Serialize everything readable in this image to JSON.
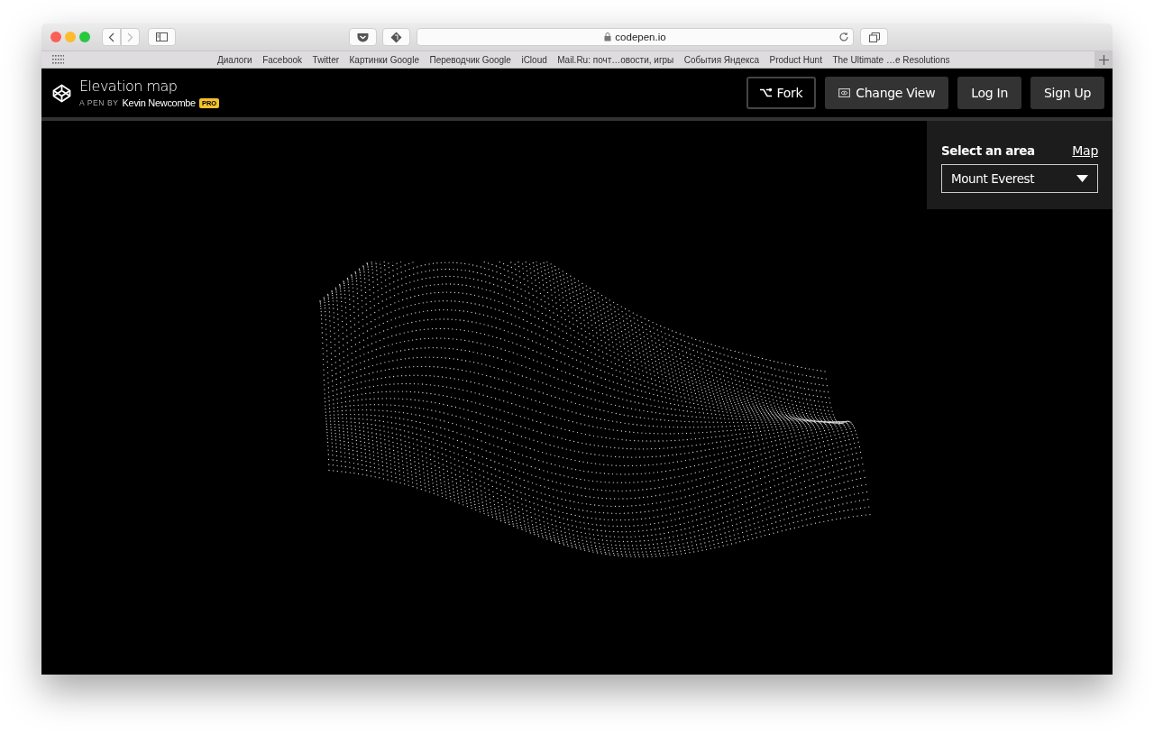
{
  "browser": {
    "address": "codepen.io",
    "bookmarks": [
      "Диалоги",
      "Facebook",
      "Twitter",
      "Картинки Google",
      "Переводчик Google",
      "iCloud",
      "Mail.Ru: почт…овости, игры",
      "События Яндекса",
      "Product Hunt",
      "The Ultimate …e Resolutions"
    ]
  },
  "pen": {
    "title": "Elevation map",
    "byline": "A PEN BY",
    "author": "Kevin Newcombe",
    "badge": "PRO",
    "buttons": [
      {
        "label": "Fork",
        "kind": "fork"
      },
      {
        "label": "Change View",
        "kind": "view"
      },
      {
        "label": "Log In",
        "kind": "plain"
      },
      {
        "label": "Sign Up",
        "kind": "plain"
      }
    ]
  },
  "panel": {
    "label": "Select an area",
    "link": "Map",
    "value": "Mount Everest"
  }
}
